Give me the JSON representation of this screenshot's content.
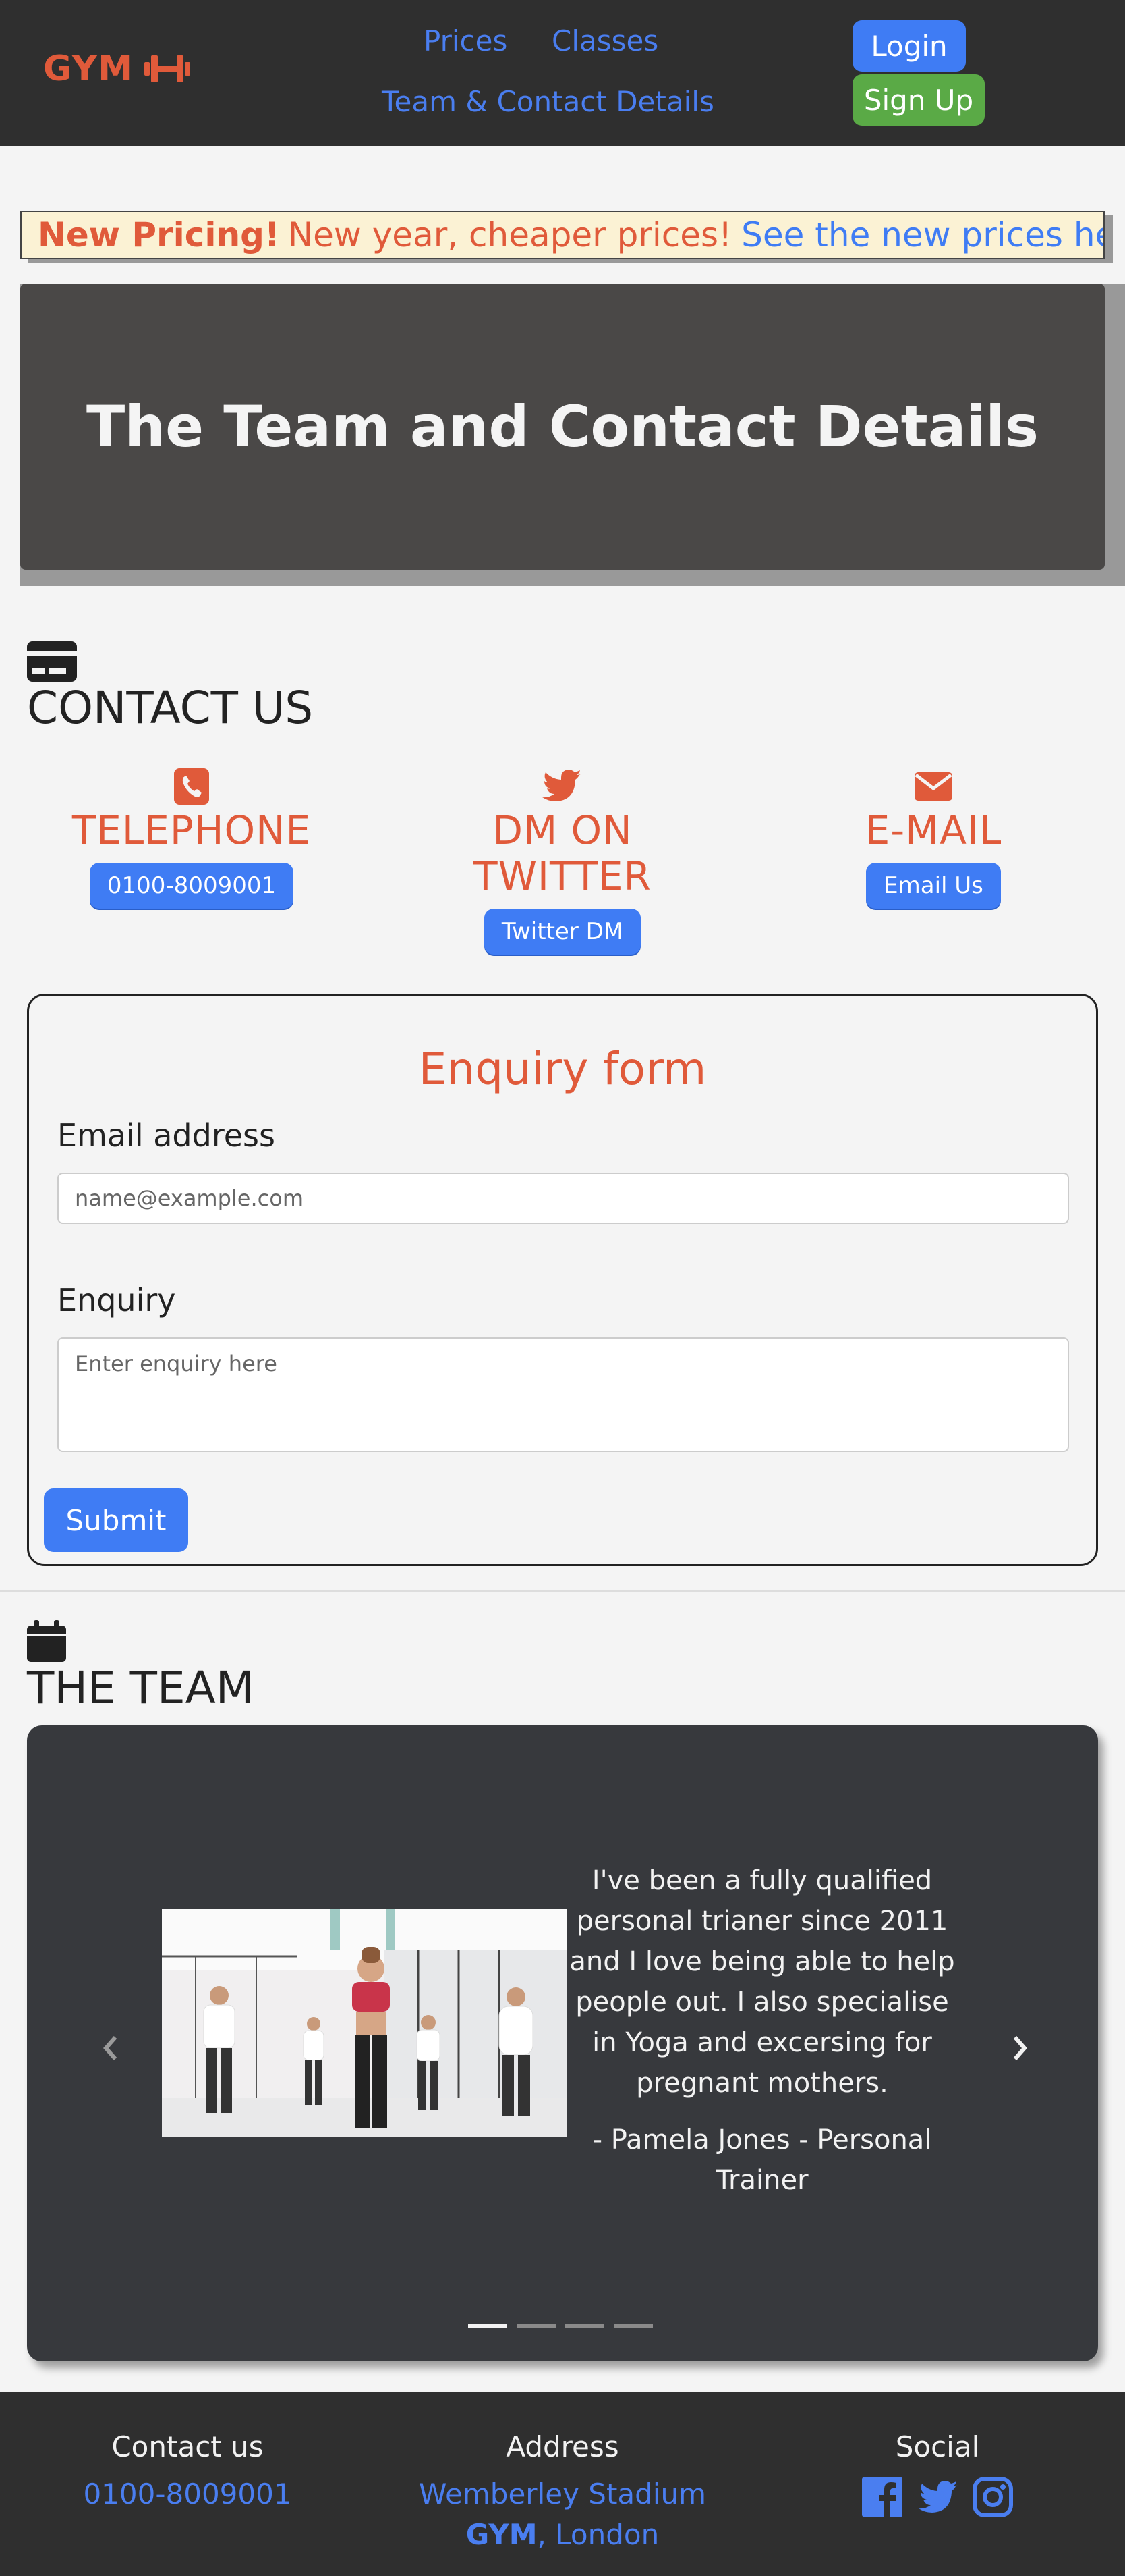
{
  "nav": {
    "brand": "GYM",
    "links": {
      "prices": "Prices",
      "classes": "Classes",
      "team": "Team & Contact Details"
    },
    "login": "Login",
    "signup": "Sign Up"
  },
  "announcement": {
    "strong": "New Pricing!",
    "text": "New year, cheaper prices!",
    "link": "See the new prices here!"
  },
  "hero": {
    "title": "The Team and Contact Details"
  },
  "contact": {
    "title": "CONTACT US",
    "icon": "card-icon",
    "items": [
      {
        "icon": "phone-icon",
        "label": "TELEPHONE",
        "button": "0100-8009001"
      },
      {
        "icon": "twitter-icon",
        "label": "DM ON TWITTER",
        "button": "Twitter DM"
      },
      {
        "icon": "envelope-icon",
        "label": "E-MAIL",
        "button": "Email Us"
      }
    ]
  },
  "form": {
    "title": "Enquiry form",
    "email_label": "Email address",
    "email_placeholder": "name@example.com",
    "enquiry_label": "Enquiry",
    "enquiry_placeholder": "Enter enquiry here",
    "submit": "Submit"
  },
  "team": {
    "title": "THE TEAM",
    "icon": "calendar-icon",
    "quote": "I've been a fully qualified personal trianer since 2011 and I love being able to help people out. I also specialise in Yoga and excersing for pregnant mothers.",
    "author": "- Pamela Jones - Personal Trainer",
    "slides": 4,
    "active_slide": 1
  },
  "footer": {
    "contact_head": "Contact us",
    "contact_phone": "0100-8009001",
    "address_head": "Address",
    "address_line1": "Wemberley Stadium",
    "address_bold": "GYM",
    "address_rest": ", London",
    "social_head": "Social",
    "social_icons": [
      "facebook-icon",
      "twitter-icon",
      "instagram-icon"
    ]
  },
  "colors": {
    "accent": "#e05a3a",
    "link": "#4a7ef0",
    "primary_button": "#3f7cf4",
    "success_button": "#5aaa46",
    "dark_bg": "#2f2f2f"
  }
}
